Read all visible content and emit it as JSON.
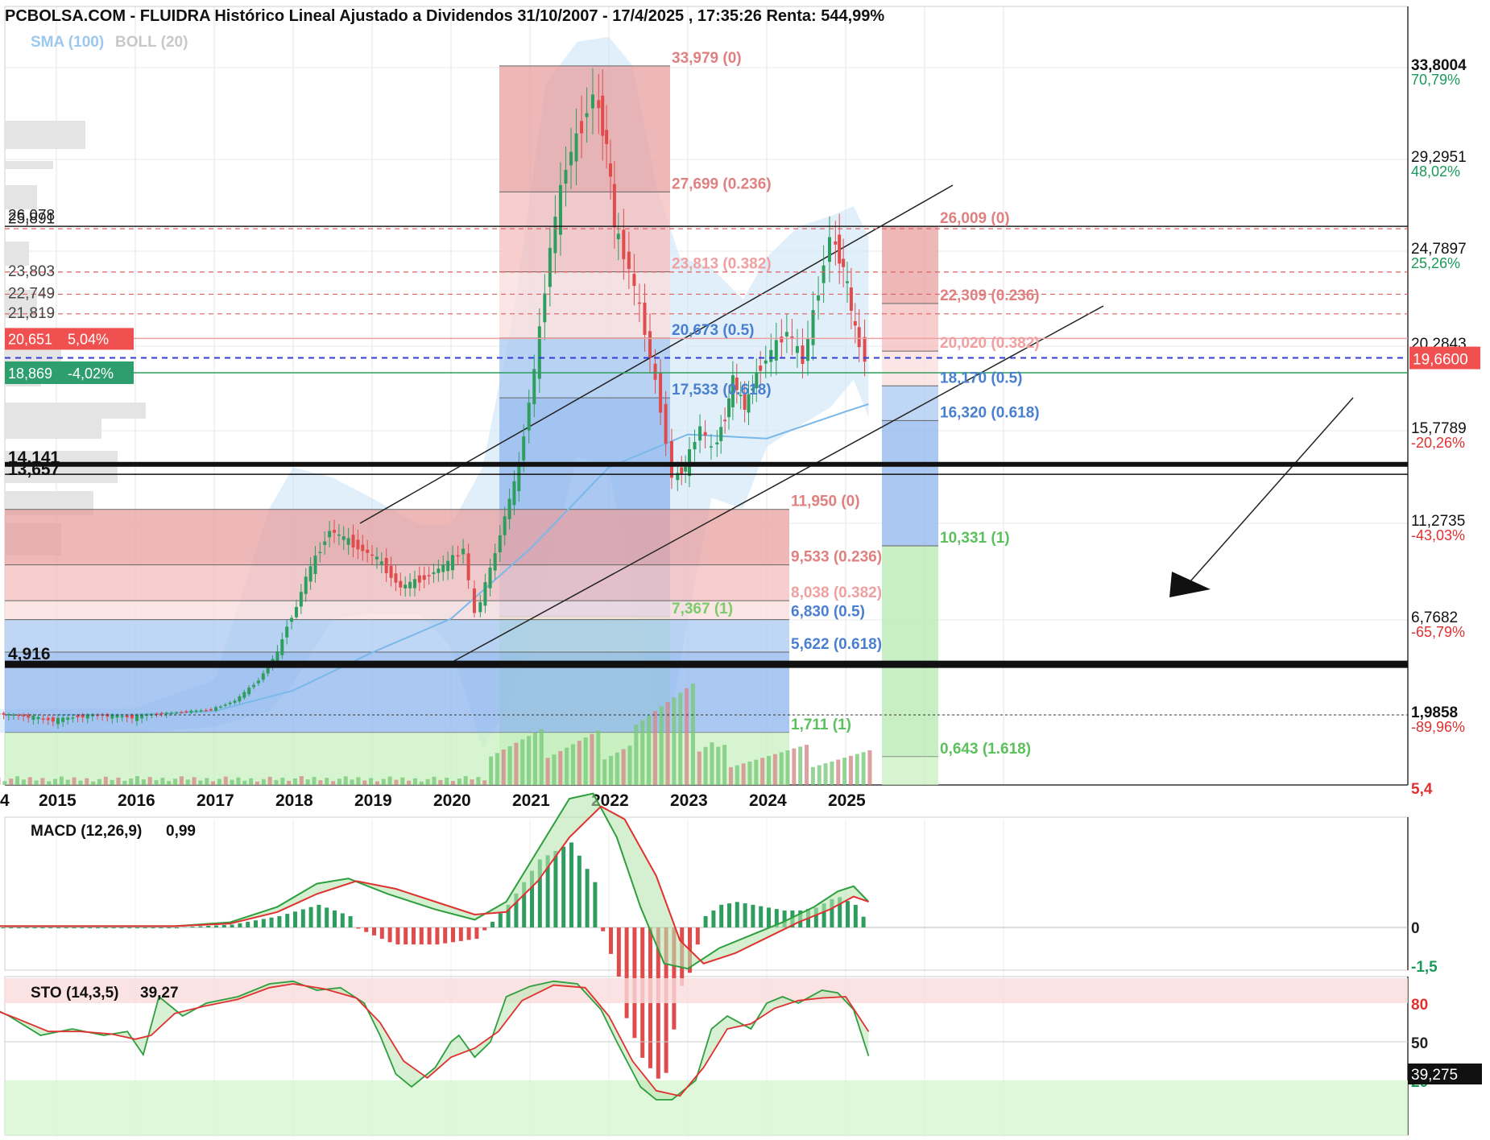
{
  "title": "PCBOLSA.COM - FLUIDRA Histórico Lineal Ajustado a Dividendos 31/10/2007 - 17/4/2025 , 17:35:26 Renta: 544,99%",
  "indicators_label": {
    "sma": "SMA (100)",
    "boll": "BOLL (20)"
  },
  "chart_data": [
    {
      "type": "line",
      "name": "price",
      "x_ticks": [
        "4",
        "2015",
        "2016",
        "2017",
        "2018",
        "2019",
        "2020",
        "2021",
        "2022",
        "2023",
        "2024",
        "2025"
      ],
      "y_axis_ticks": [
        {
          "value": "33,8004",
          "pct": "70,79%",
          "pct_color": "#1a9a5a"
        },
        {
          "value": "29,2951",
          "pct": "48,02%",
          "pct_color": "#1a9a5a"
        },
        {
          "value": "24,7897",
          "pct": "25,26%",
          "pct_color": "#1a9a5a"
        },
        {
          "value": "20,2843",
          "pct": "",
          "pct_color": "#1a9a5a"
        },
        {
          "value": "15,7789",
          "pct": "-20,26%",
          "pct_color": "#e03030"
        },
        {
          "value": "11,2735",
          "pct": "-43,03%",
          "pct_color": "#e03030"
        },
        {
          "value": "6,7682",
          "pct": "-65,79%",
          "pct_color": "#e03030"
        },
        {
          "value": "1,9858",
          "pct": "-89,96%",
          "pct_color": "#e03030"
        }
      ],
      "current_price": "19,6600",
      "left_levels": [
        "26,078",
        "23,803",
        "22,749",
        "21,819",
        "14,141",
        "4,916"
      ],
      "left_levels_overlap": [
        "25,891",
        "13,657"
      ],
      "resistance_badge": {
        "price": "20,651",
        "pct": "5,04%"
      },
      "support_badge": {
        "price": "18,869",
        "pct": "-4,02%"
      },
      "fib_2020": [
        {
          "label": "33,979 (0)",
          "color": "#e08080",
          "value": 33.979
        },
        {
          "label": "27,699 (0.236)",
          "color": "#e08080",
          "value": 27.699
        },
        {
          "label": "23,813 (0.382)",
          "color": "#f0a0a0",
          "value": 23.813
        },
        {
          "label": "20,673 (0.5)",
          "color": "#4a7fd0",
          "value": 20.673
        },
        {
          "label": "17,533 (0.618)",
          "color": "#4a7fd0",
          "value": 17.533
        },
        {
          "label": "7,367 (1)",
          "color": "#7acc6a",
          "value": 7.367
        }
      ],
      "fib_2025": [
        {
          "label": "26,009 (0)",
          "color": "#e08080",
          "value": 26.009
        },
        {
          "label": "22,309 (0.236)",
          "color": "#e08080",
          "value": 22.309
        },
        {
          "label": "20,020 (0.382)",
          "color": "#f0a0a0",
          "value": 20.02
        },
        {
          "label": "18,170 (0.5)",
          "color": "#4a7fd0",
          "value": 18.17
        },
        {
          "label": "16,320 (0.618)",
          "color": "#4a7fd0",
          "value": 16.32
        },
        {
          "label": "10,331 (1)",
          "color": "#5cc05c",
          "value": 10.331
        },
        {
          "label": "0,643 (1.618)",
          "color": "#5cc05c",
          "value": 0.643
        }
      ],
      "fib_2018": [
        {
          "label": "11,950 (0)",
          "color": "#e08080",
          "value": 11.95
        },
        {
          "label": "9,533 (0.236)",
          "color": "#e08080",
          "value": 9.533
        },
        {
          "label": "8,038 (0.382)",
          "color": "#f0a0a0",
          "value": 8.038
        },
        {
          "label": "6,830 (0.5)",
          "color": "#4a7fd0",
          "value": 6.83
        },
        {
          "label": "5,622 (0.618)",
          "color": "#4a7fd0",
          "value": 5.622
        },
        {
          "label": "1,711 (1)",
          "color": "#5cc05c",
          "value": 1.711
        }
      ],
      "price_path": [
        [
          2014.0,
          2.1
        ],
        [
          2014.5,
          2.0
        ],
        [
          2015.0,
          1.9
        ],
        [
          2015.5,
          2.0
        ],
        [
          2016.0,
          1.95
        ],
        [
          2016.5,
          2.1
        ],
        [
          2017.0,
          2.3
        ],
        [
          2017.3,
          2.8
        ],
        [
          2017.6,
          4.0
        ],
        [
          2017.9,
          6.0
        ],
        [
          2018.2,
          9.0
        ],
        [
          2018.5,
          11.0
        ],
        [
          2018.8,
          10.4
        ],
        [
          2019.1,
          9.8
        ],
        [
          2019.4,
          8.6
        ],
        [
          2019.7,
          9.0
        ],
        [
          2020.0,
          9.6
        ],
        [
          2020.2,
          10.2
        ],
        [
          2020.35,
          7.4
        ],
        [
          2020.6,
          10.0
        ],
        [
          2020.9,
          14.0
        ],
        [
          2021.1,
          19.0
        ],
        [
          2021.3,
          25.0
        ],
        [
          2021.5,
          29.0
        ],
        [
          2021.7,
          31.0
        ],
        [
          2021.85,
          32.5
        ],
        [
          2022.0,
          30.0
        ],
        [
          2022.1,
          26.0
        ],
        [
          2022.3,
          24.0
        ],
        [
          2022.5,
          21.0
        ],
        [
          2022.7,
          17.0
        ],
        [
          2022.85,
          13.5
        ],
        [
          2023.0,
          14.0
        ],
        [
          2023.2,
          16.0
        ],
        [
          2023.35,
          14.8
        ],
        [
          2023.5,
          16.5
        ],
        [
          2023.6,
          18.5
        ],
        [
          2023.75,
          17.0
        ],
        [
          2023.9,
          18.8
        ],
        [
          2024.1,
          20.0
        ],
        [
          2024.3,
          21.0
        ],
        [
          2024.5,
          19.5
        ],
        [
          2024.7,
          23.0
        ],
        [
          2024.85,
          25.5
        ],
        [
          2025.0,
          24.0
        ],
        [
          2025.15,
          21.0
        ],
        [
          2025.29,
          19.66
        ]
      ],
      "sma_path": [
        [
          2015.0,
          2.0
        ],
        [
          2016.0,
          2.0
        ],
        [
          2017.0,
          2.2
        ],
        [
          2018.0,
          3.4
        ],
        [
          2019.0,
          5.6
        ],
        [
          2020.0,
          7.0
        ],
        [
          2021.0,
          10.2
        ],
        [
          2022.0,
          14.0
        ],
        [
          2023.0,
          15.6
        ],
        [
          2024.0,
          15.4
        ],
        [
          2025.0,
          16.8
        ],
        [
          2025.29,
          17.2
        ]
      ],
      "boll_upper": [
        [
          2014.0,
          2.3
        ],
        [
          2016.0,
          2.4
        ],
        [
          2017.0,
          4.0
        ],
        [
          2017.7,
          12.0
        ],
        [
          2018.0,
          14.0
        ],
        [
          2018.5,
          13.5
        ],
        [
          2019.0,
          12.5
        ],
        [
          2019.6,
          11.2
        ],
        [
          2020.0,
          11.2
        ],
        [
          2020.4,
          14.0
        ],
        [
          2020.8,
          22.0
        ],
        [
          2021.2,
          33.0
        ],
        [
          2021.6,
          36.5
        ],
        [
          2022.0,
          37.0
        ],
        [
          2022.3,
          34.0
        ],
        [
          2022.6,
          28.0
        ],
        [
          2022.9,
          24.5
        ],
        [
          2023.3,
          24.0
        ],
        [
          2023.7,
          22.5
        ],
        [
          2024.0,
          24.5
        ],
        [
          2024.4,
          26.0
        ],
        [
          2024.8,
          26.5
        ],
        [
          2025.1,
          27.0
        ],
        [
          2025.29,
          25.5
        ]
      ],
      "boll_lower": [
        [
          2014.0,
          1.7
        ],
        [
          2016.0,
          1.7
        ],
        [
          2017.0,
          1.8
        ],
        [
          2017.7,
          2.2
        ],
        [
          2018.0,
          3.8
        ],
        [
          2018.5,
          7.0
        ],
        [
          2019.0,
          7.5
        ],
        [
          2019.6,
          7.5
        ],
        [
          2020.0,
          5.8
        ],
        [
          2020.4,
          1.0
        ],
        [
          2020.8,
          3.0
        ],
        [
          2021.2,
          9.0
        ],
        [
          2021.6,
          14.5
        ],
        [
          2022.0,
          14.0
        ],
        [
          2022.4,
          6.0
        ],
        [
          2022.7,
          0.5
        ],
        [
          2023.0,
          7.0
        ],
        [
          2023.3,
          12.5
        ],
        [
          2023.7,
          12.0
        ],
        [
          2024.0,
          15.0
        ],
        [
          2024.4,
          16.0
        ],
        [
          2024.8,
          17.0
        ],
        [
          2025.1,
          18.5
        ],
        [
          2025.29,
          16.5
        ]
      ]
    },
    {
      "type": "line",
      "name": "macd",
      "label": "MACD (12,26,9)",
      "value": "0,99",
      "y_ticks": [
        {
          "label": "5,4",
          "color": "#e03030",
          "value": 5.4
        },
        {
          "label": "0",
          "color": "#222222",
          "value": 0
        },
        {
          "label": "-1,5",
          "color": "#1a9a5a",
          "value": -1.5
        }
      ],
      "macd_path": [
        [
          2014.0,
          0.05
        ],
        [
          2016.5,
          0.05
        ],
        [
          2017.2,
          0.2
        ],
        [
          2017.8,
          0.8
        ],
        [
          2018.3,
          1.7
        ],
        [
          2018.7,
          1.9
        ],
        [
          2019.2,
          1.3
        ],
        [
          2019.8,
          0.7
        ],
        [
          2020.3,
          0.3
        ],
        [
          2020.7,
          1.0
        ],
        [
          2021.1,
          3.0
        ],
        [
          2021.5,
          5.0
        ],
        [
          2021.8,
          5.2
        ],
        [
          2022.1,
          3.5
        ],
        [
          2022.4,
          0.8
        ],
        [
          2022.7,
          -1.4
        ],
        [
          2023.0,
          -1.6
        ],
        [
          2023.4,
          -0.8
        ],
        [
          2023.8,
          -0.3
        ],
        [
          2024.2,
          0.2
        ],
        [
          2024.6,
          0.8
        ],
        [
          2024.9,
          1.4
        ],
        [
          2025.1,
          1.6
        ],
        [
          2025.29,
          1.0
        ]
      ],
      "signal_path": [
        [
          2014.0,
          0.05
        ],
        [
          2016.5,
          0.05
        ],
        [
          2017.2,
          0.15
        ],
        [
          2017.8,
          0.6
        ],
        [
          2018.3,
          1.3
        ],
        [
          2018.8,
          1.8
        ],
        [
          2019.3,
          1.5
        ],
        [
          2019.8,
          1.0
        ],
        [
          2020.3,
          0.5
        ],
        [
          2020.7,
          0.6
        ],
        [
          2021.1,
          1.8
        ],
        [
          2021.5,
          3.5
        ],
        [
          2021.9,
          4.7
        ],
        [
          2022.2,
          4.2
        ],
        [
          2022.6,
          2.0
        ],
        [
          2022.9,
          -0.5
        ],
        [
          2023.2,
          -1.4
        ],
        [
          2023.6,
          -1.0
        ],
        [
          2024.0,
          -0.4
        ],
        [
          2024.4,
          0.2
        ],
        [
          2024.8,
          0.7
        ],
        [
          2025.1,
          1.2
        ],
        [
          2025.29,
          1.0
        ]
      ]
    },
    {
      "type": "line",
      "name": "stochastic",
      "label": "STO (14,3,5)",
      "value": "39,27",
      "current": "39,275",
      "y_ticks": [
        {
          "label": "80",
          "color": "#e03030",
          "value": 80
        },
        {
          "label": "50",
          "color": "#222222",
          "value": 50
        },
        {
          "label": "20",
          "color": "#1a9a5a",
          "value": 20
        }
      ],
      "k_path": [
        [
          2014.0,
          82
        ],
        [
          2014.4,
          70
        ],
        [
          2014.8,
          55
        ],
        [
          2015.2,
          60
        ],
        [
          2015.6,
          55
        ],
        [
          2015.9,
          58
        ],
        [
          2016.1,
          40
        ],
        [
          2016.3,
          85
        ],
        [
          2016.6,
          70
        ],
        [
          2016.9,
          80
        ],
        [
          2017.3,
          85
        ],
        [
          2017.7,
          95
        ],
        [
          2018.0,
          97
        ],
        [
          2018.3,
          90
        ],
        [
          2018.6,
          92
        ],
        [
          2018.9,
          80
        ],
        [
          2019.1,
          55
        ],
        [
          2019.3,
          25
        ],
        [
          2019.5,
          15
        ],
        [
          2019.8,
          30
        ],
        [
          2020.0,
          50
        ],
        [
          2020.1,
          55
        ],
        [
          2020.3,
          38
        ],
        [
          2020.5,
          50
        ],
        [
          2020.7,
          85
        ],
        [
          2021.0,
          93
        ],
        [
          2021.3,
          97
        ],
        [
          2021.6,
          95
        ],
        [
          2021.9,
          75
        ],
        [
          2022.1,
          50
        ],
        [
          2022.4,
          15
        ],
        [
          2022.6,
          5
        ],
        [
          2022.8,
          5
        ],
        [
          2023.1,
          20
        ],
        [
          2023.3,
          60
        ],
        [
          2023.5,
          70
        ],
        [
          2023.8,
          60
        ],
        [
          2024.0,
          80
        ],
        [
          2024.2,
          85
        ],
        [
          2024.4,
          80
        ],
        [
          2024.7,
          90
        ],
        [
          2024.9,
          88
        ],
        [
          2025.1,
          75
        ],
        [
          2025.29,
          39
        ]
      ],
      "d_path": [
        [
          2014.0,
          80
        ],
        [
          2014.5,
          68
        ],
        [
          2014.9,
          58
        ],
        [
          2015.3,
          58
        ],
        [
          2015.7,
          56
        ],
        [
          2016.0,
          52
        ],
        [
          2016.2,
          55
        ],
        [
          2016.5,
          72
        ],
        [
          2016.9,
          78
        ],
        [
          2017.3,
          83
        ],
        [
          2017.7,
          92
        ],
        [
          2018.0,
          95
        ],
        [
          2018.4,
          91
        ],
        [
          2018.8,
          84
        ],
        [
          2019.1,
          65
        ],
        [
          2019.4,
          35
        ],
        [
          2019.7,
          22
        ],
        [
          2020.0,
          38
        ],
        [
          2020.3,
          45
        ],
        [
          2020.6,
          58
        ],
        [
          2020.9,
          82
        ],
        [
          2021.3,
          94
        ],
        [
          2021.7,
          92
        ],
        [
          2022.0,
          70
        ],
        [
          2022.3,
          35
        ],
        [
          2022.6,
          12
        ],
        [
          2022.9,
          8
        ],
        [
          2023.2,
          30
        ],
        [
          2023.5,
          60
        ],
        [
          2023.8,
          64
        ],
        [
          2024.1,
          76
        ],
        [
          2024.4,
          82
        ],
        [
          2024.7,
          84
        ],
        [
          2025.0,
          85
        ],
        [
          2025.29,
          58
        ]
      ]
    }
  ]
}
